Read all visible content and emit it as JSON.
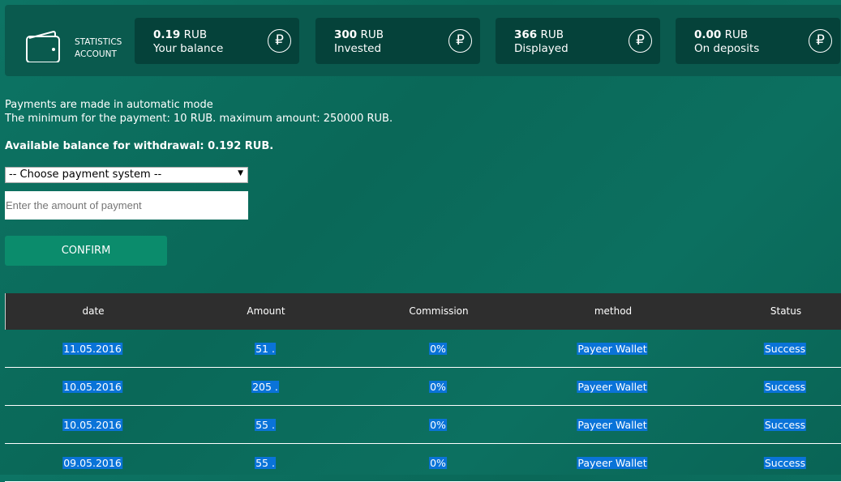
{
  "stats": {
    "label_line1": "STATISTICS",
    "label_line2": "ACCOUNT",
    "cards": [
      {
        "value": "0.19",
        "unit": "RUB",
        "label": "Your balance"
      },
      {
        "value": "300",
        "unit": "RUB",
        "label": "Invested"
      },
      {
        "value": "366",
        "unit": "RUB",
        "label": "Displayed"
      },
      {
        "value": "0.00",
        "unit": "RUB",
        "label": "On deposits"
      }
    ],
    "currency_symbol": "₽"
  },
  "info": {
    "line1": "Payments are made in automatic mode",
    "line2": "The minimum for the payment: 10 RUB. maximum amount: 250000 RUB.",
    "available": "Available balance for withdrawal: 0.192 RUB."
  },
  "form": {
    "select_value": "-- Choose payment system --",
    "amount_placeholder": "Enter the amount of payment",
    "confirm_label": "CONFIRM"
  },
  "table": {
    "headers": [
      "date",
      "Amount",
      "Commission",
      "method",
      "Status"
    ],
    "rows": [
      [
        "11.05.2016",
        "51 .",
        "0%",
        "Payeer Wallet",
        "Success"
      ],
      [
        "10.05.2016",
        "205 .",
        "0%",
        "Payeer Wallet",
        "Success"
      ],
      [
        "10.05.2016",
        "55 .",
        "0%",
        "Payeer Wallet",
        "Success"
      ],
      [
        "09.05.2016",
        "55 .",
        "0%",
        "Payeer Wallet",
        "Success"
      ]
    ]
  },
  "colors": {
    "background": "#0a6b5b",
    "header": "#2e2e2e",
    "button": "#0b8c6c",
    "selection": "#0a73d8"
  }
}
